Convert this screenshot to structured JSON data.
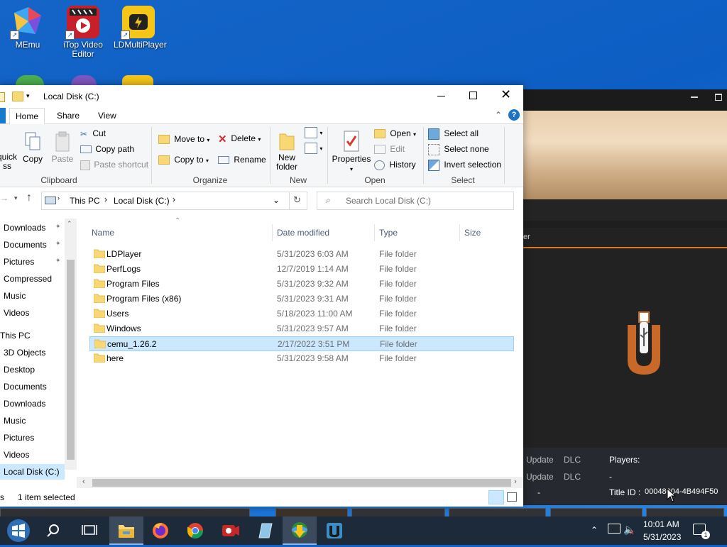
{
  "desktop": {
    "icons": [
      {
        "label": "MEmu"
      },
      {
        "label": "iTop Video Editor"
      },
      {
        "label": "LDMultiPlayer"
      }
    ]
  },
  "bgapp": {
    "tab_label": "er",
    "info": {
      "update1": "Update",
      "dlc1": "DLC",
      "players_label": "Players:",
      "update2": "Update",
      "dlc2": "DLC",
      "players_value": "-",
      "dash": "-",
      "title_id_label": "Title ID :",
      "title_id_value": "00048004-4B494F50"
    }
  },
  "explorer": {
    "title": "Local Disk (C:)",
    "tabs": [
      "Home",
      "Share",
      "View"
    ],
    "ribbon": {
      "clipboard": {
        "label": "Clipboard",
        "quick": "quick",
        "quick2": "ss",
        "copy": "Copy",
        "paste": "Paste",
        "cut": "Cut",
        "copy_path": "Copy path",
        "paste_shortcut": "Paste shortcut"
      },
      "organize": {
        "label": "Organize",
        "move_to": "Move to",
        "copy_to": "Copy to",
        "delete": "Delete",
        "rename": "Rename"
      },
      "new": {
        "label": "New",
        "new_folder_1": "New",
        "new_folder_2": "folder"
      },
      "open": {
        "label": "Open",
        "properties": "Properties",
        "open": "Open",
        "edit": "Edit",
        "history": "History"
      },
      "select": {
        "label": "Select",
        "select_all": "Select all",
        "select_none": "Select none",
        "invert": "Invert selection"
      }
    },
    "address": {
      "crumbs": [
        "This PC",
        "Local Disk (C:)"
      ],
      "search_placeholder": "Search Local Disk (C:)"
    },
    "nav": {
      "quick_access": [
        {
          "label": "Downloads",
          "pinned": true
        },
        {
          "label": "Documents",
          "pinned": true
        },
        {
          "label": "Pictures",
          "pinned": true
        },
        {
          "label": "Compressed"
        },
        {
          "label": "Music"
        },
        {
          "label": "Videos"
        }
      ],
      "this_pc": "This PC",
      "pc_items": [
        {
          "label": "3D Objects"
        },
        {
          "label": "Desktop"
        },
        {
          "label": "Documents"
        },
        {
          "label": "Downloads"
        },
        {
          "label": "Music"
        },
        {
          "label": "Pictures"
        },
        {
          "label": "Videos"
        },
        {
          "label": "Local Disk (C:)"
        }
      ]
    },
    "columns": {
      "name": "Name",
      "date": "Date modified",
      "type": "Type",
      "size": "Size"
    },
    "files": [
      {
        "name": "LDPlayer",
        "date": "5/31/2023 6:03 AM",
        "type": "File folder"
      },
      {
        "name": "PerfLogs",
        "date": "12/7/2019 1:14 AM",
        "type": "File folder"
      },
      {
        "name": "Program Files",
        "date": "5/31/2023 9:32 AM",
        "type": "File folder"
      },
      {
        "name": "Program Files (x86)",
        "date": "5/31/2023 9:31 AM",
        "type": "File folder"
      },
      {
        "name": "Users",
        "date": "5/18/2023 11:00 AM",
        "type": "File folder"
      },
      {
        "name": "Windows",
        "date": "5/31/2023 9:57 AM",
        "type": "File folder"
      },
      {
        "name": "cemu_1.26.2",
        "date": "2/17/2022 3:51 PM",
        "type": "File folder",
        "selected": true
      },
      {
        "name": "here",
        "date": "5/31/2023 9:58 AM",
        "type": "File folder"
      }
    ],
    "status": {
      "count": "s",
      "selected": "1 item selected"
    }
  },
  "taskbar": {
    "time": "10:01 AM",
    "date": "5/31/2023",
    "notifications": "1"
  },
  "colors": {
    "accent": "#0078d7",
    "selection": "#cce8ff",
    "folder": "#f8d775",
    "taskbar": "#1c2a3a",
    "desktop": "#1565c8"
  }
}
